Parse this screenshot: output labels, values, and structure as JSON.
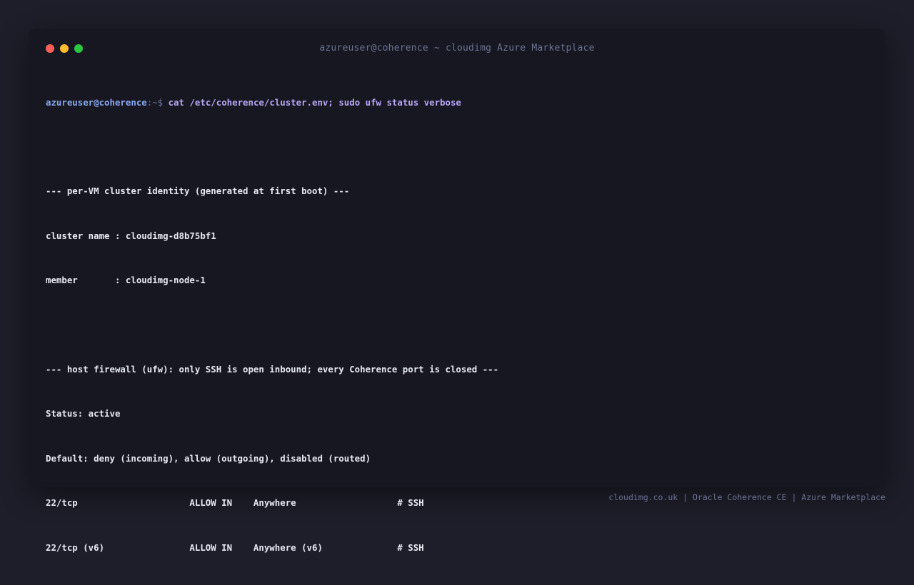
{
  "window": {
    "title": "azureuser@coherence ~ cloudimg Azure Marketplace",
    "buttons": {
      "close": "close",
      "minimize": "minimize",
      "maximize": "maximize"
    }
  },
  "prompt": {
    "user_host": "azureuser@coherence",
    "path_symbol": ":~$",
    "command": " cat /etc/coherence/cluster.env; sudo ufw status verbose"
  },
  "output": {
    "identity_header": "--- per-VM cluster identity (generated at first boot) ---",
    "cluster_name_line": "cluster name : cloudimg-d8b75bf1",
    "member_line": "member       : cloudimg-node-1",
    "firewall_header": "--- host firewall (ufw): only SSH is open inbound; every Coherence port is closed ---",
    "status_line": "Status: active",
    "default_line": "Default: deny (incoming), allow (outgoing), disabled (routed)",
    "rules": [
      "22/tcp                     ALLOW IN    Anywhere                   # SSH",
      "22/tcp (v6)                ALLOW IN    Anywhere (v6)              # SSH"
    ]
  },
  "footer": {
    "text": "cloudimg.co.uk | Oracle Coherence CE | Azure Marketplace"
  },
  "colors": {
    "background": "#1d1e29",
    "window": "#161720",
    "text": "#e6e8f2",
    "prompt_user": "#89a8f5",
    "command": "#b9a6f7",
    "muted": "#6c7394",
    "close": "#ff5f57",
    "minimize": "#febc2e",
    "maximize": "#28c840"
  }
}
